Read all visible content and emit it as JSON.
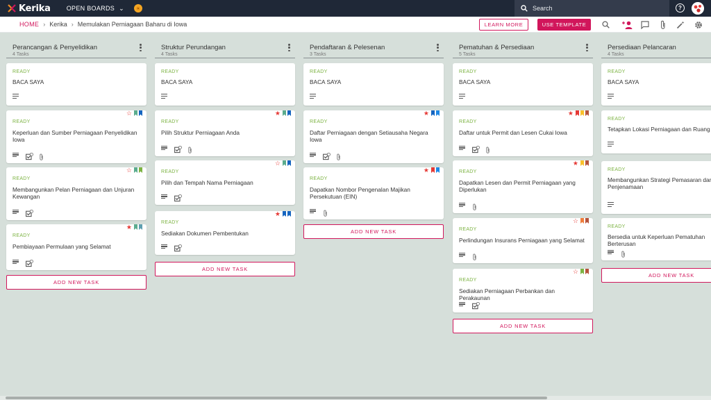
{
  "app": {
    "logo": "Kerika"
  },
  "topbar": {
    "open_boards": "OPEN BOARDS",
    "search_placeholder": "Search"
  },
  "breadcrumb": {
    "home": "HOME",
    "org": "Kerika",
    "board": "Memulakan Perniagaan Baharu di Iowa"
  },
  "actions": {
    "learn_more": "LEARN MORE",
    "use_template": "USE TEMPLATE"
  },
  "board": {
    "add_task_label": "ADD NEW TASK",
    "columns": [
      {
        "title": "Perancangan & Penyelidikan",
        "count": "4 Tasks",
        "cards": [
          {
            "status": "READY",
            "title": "BACA SAYA",
            "icons": [
              "description"
            ]
          },
          {
            "status": "READY",
            "title": "Keperluan dan Sumber Perniagaan Penyelidikan Iowa",
            "star": "outline",
            "flags": [
              "#5bac8e",
              "#1565c0"
            ],
            "icons": [
              "description",
              "checklist",
              "attachment"
            ]
          },
          {
            "status": "READY",
            "title": "Membangunkan Pelan Perniagaan dan Unjuran Kewangan",
            "star": "outline",
            "flags": [
              "#5bac8e",
              "#7cb342"
            ],
            "icons": [
              "description",
              "checklist"
            ]
          },
          {
            "status": "READY",
            "title": "Pembiayaan Permulaan yang Selamat",
            "star": "filled",
            "flags": [
              "#5bac8e",
              "#5e9fb0"
            ],
            "icons": [
              "description",
              "checklist"
            ]
          }
        ]
      },
      {
        "title": "Struktur Perundangan",
        "count": "4 Tasks",
        "cards": [
          {
            "status": "READY",
            "title": "BACA SAYA",
            "icons": [
              "description"
            ]
          },
          {
            "status": "READY",
            "title": "Pilih Struktur Perniagaan Anda",
            "star": "filled",
            "flags": [
              "#5bac8e",
              "#1565c0"
            ],
            "icons": [
              "description",
              "checklist",
              "attachment"
            ]
          },
          {
            "status": "READY",
            "title": "Pilih dan Tempah Nama Perniagaan",
            "star": "outline",
            "flags": [
              "#5bac8e",
              "#1565c0"
            ],
            "icons": [
              "description",
              "checklist"
            ]
          },
          {
            "status": "READY",
            "title": "Sediakan Dokumen Pembentukan",
            "star": "filled",
            "flags": [
              "#1565c0",
              "#1565c0"
            ],
            "icons": [
              "description",
              "checklist"
            ]
          }
        ]
      },
      {
        "title": "Pendaftaran & Pelesenan",
        "count": "3 Tasks",
        "cards": [
          {
            "status": "READY",
            "title": "BACA SAYA",
            "icons": [
              "description"
            ]
          },
          {
            "status": "READY",
            "title": "Daftar Perniagaan dengan Setiausaha Negara Iowa",
            "star": "filled",
            "flags": [
              "#1565c0",
              "#1e88e5"
            ],
            "icons": [
              "description",
              "checklist",
              "attachment"
            ]
          },
          {
            "status": "READY",
            "title": "Dapatkan Nombor Pengenalan Majikan Persekutuan (EIN)",
            "star": "filled",
            "flags": [
              "#e53935",
              "#1e88e5"
            ],
            "icons": [
              "description",
              "attachment"
            ]
          }
        ]
      },
      {
        "title": "Pematuhan & Persediaan",
        "count": "5 Tasks",
        "cards": [
          {
            "status": "READY",
            "title": "BACA SAYA",
            "icons": [
              "description"
            ]
          },
          {
            "status": "READY",
            "title": "Daftar untuk Permit dan Lesen Cukai Iowa",
            "star": "filled",
            "flags": [
              "#e53935",
              "#f9c02b",
              "#b5533c"
            ],
            "icons": [
              "description",
              "checklist",
              "attachment"
            ]
          },
          {
            "status": "READY",
            "title": "Dapatkan Lesen dan Permit Perniagaan yang Diperlukan",
            "star": "filled",
            "flags": [
              "#f9c02b",
              "#b5533c"
            ],
            "icons": [
              "description",
              "attachment"
            ]
          },
          {
            "status": "READY",
            "title": "Perlindungan Insurans Perniagaan yang Selamat",
            "star": "outline",
            "flags": [
              "#ef7d3b",
              "#b5533c"
            ],
            "icons": [
              "description",
              "attachment"
            ]
          },
          {
            "status": "READY",
            "title": "Sediakan Perniagaan Perbankan dan Perakaunan",
            "star": "outline",
            "flags": [
              "#7cb342",
              "#b5533c"
            ],
            "icons": [
              "description",
              "checklist"
            ]
          }
        ]
      },
      {
        "title": "Persediaan Pelancaran",
        "count": "4 Tasks",
        "cards": [
          {
            "status": "READY",
            "title": "BACA SAYA",
            "icons": [
              "description"
            ]
          },
          {
            "status": "READY",
            "title": "Tetapkan Lokasi Perniagaan dan Ruang Kerja",
            "icons": [
              "description"
            ]
          },
          {
            "status": "READY",
            "title": "Membangunkan Strategi Pemasaran dan Penjenamaan",
            "icons": [
              "description"
            ]
          },
          {
            "status": "READY",
            "title": "Bersedia untuk Keperluan Pematuhan Berterusan",
            "icons": [
              "description",
              "attachment"
            ]
          }
        ]
      }
    ]
  },
  "colors": {
    "accent": "#d1165b",
    "ready": "#7cb342",
    "topbar": "#1f2837",
    "board_bg": "#d6dfda"
  }
}
